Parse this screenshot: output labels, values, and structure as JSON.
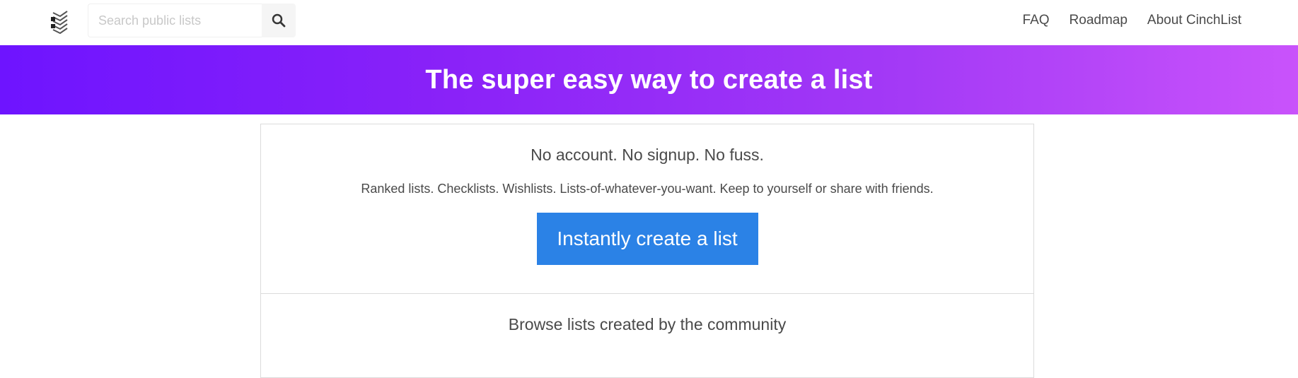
{
  "navbar": {
    "logo_icon": "stacked-checklist-logo-icon",
    "search": {
      "placeholder": "Search public lists",
      "value": "",
      "button_icon": "search-icon"
    },
    "links": [
      "FAQ",
      "Roadmap",
      "About CinchList"
    ]
  },
  "hero": {
    "title": "The super easy way to create a list",
    "gradient_start": "#6e14ff",
    "gradient_end": "#c953fb"
  },
  "card": {
    "tagline": "No account. No signup. No fuss.",
    "subtext": "Ranked lists. Checklists. Wishlists. Lists-of-whatever-you-want. Keep to yourself or share with friends.",
    "create_button_label": "Instantly create a list",
    "create_button_color": "#2b82e6",
    "browse_title": "Browse lists created by the community"
  }
}
